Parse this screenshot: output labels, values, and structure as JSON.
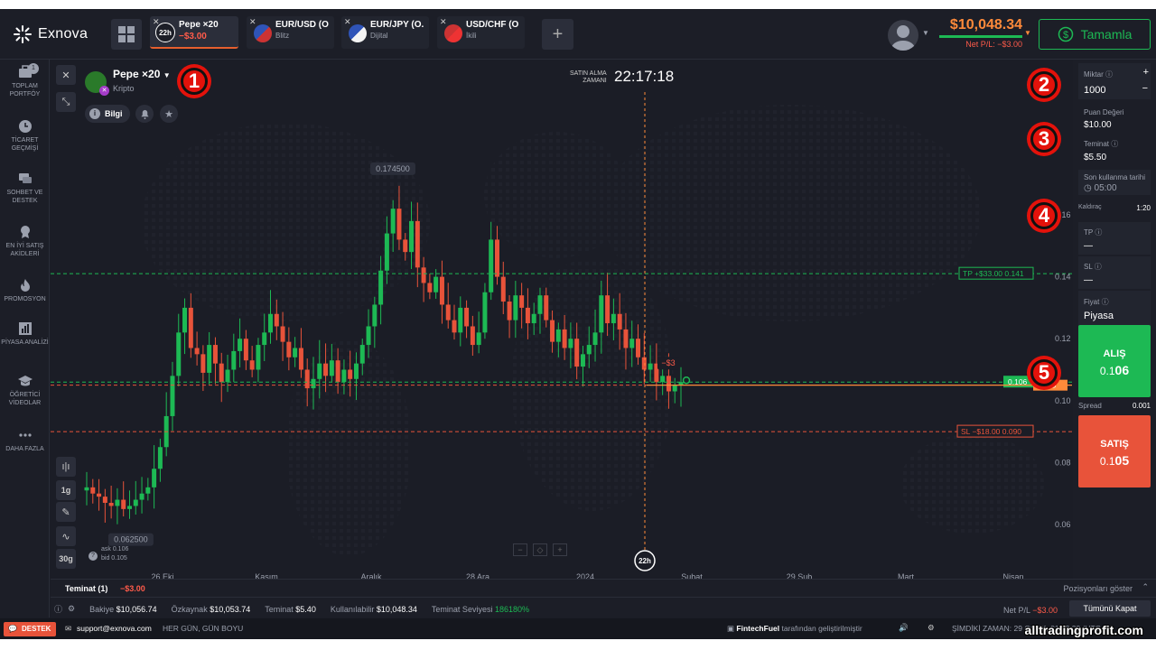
{
  "brand": "Exnova",
  "tabs": [
    {
      "name": "Pepe ×20",
      "sub": "−$3.00",
      "icon": "22h"
    },
    {
      "name": "EUR/USD (O...",
      "sub": "Blitz",
      "icon": "OTC"
    },
    {
      "name": "EUR/JPY (O...",
      "sub": "Dijital",
      "icon": "OTC"
    },
    {
      "name": "USD/CHF (O...",
      "sub": "İkili",
      "icon": "OTC"
    }
  ],
  "account": {
    "balance": "$10,048.34",
    "pl": "Net P/L: −$3.00",
    "deposit_label": "Tamamla"
  },
  "sidebar": [
    {
      "label": "TOPLAM PORTFÖY",
      "icon": "portfolio-icon",
      "badge": "1"
    },
    {
      "label": "TİCARET GEÇMİŞİ",
      "icon": "history-icon"
    },
    {
      "label": "SOHBET VE DESTEK",
      "icon": "chat-icon"
    },
    {
      "label": "EN İYİ SATIŞ AKİDLERİ",
      "icon": "award-icon"
    },
    {
      "label": "PROMOSYON",
      "icon": "flame-icon"
    },
    {
      "label": "PİYASA ANALİZİ",
      "icon": "chart-icon"
    },
    {
      "label": "ÖĞRETİCİ VİDEOLAR",
      "icon": "education-icon"
    },
    {
      "label": "DAHA FAZLA",
      "icon": "more-icon"
    }
  ],
  "asset": {
    "name": "Pepe ×20",
    "category": "Kripto",
    "info_label": "Bilgi"
  },
  "expiry": {
    "label_line1": "SATIN ALMA",
    "label_line2": "ZAMANI",
    "time": "22:17:18",
    "marker": "22h"
  },
  "chart_controls": {
    "timeframe": "1g",
    "zoom": "30g",
    "ask": "ask 0.106",
    "bid": "bid 0.105"
  },
  "chart_data": {
    "type": "candlestick",
    "x_ticks": [
      "26 Eki",
      "Kasım",
      "Aralık",
      "28 Ara",
      "2024",
      "Şubat",
      "29 Şub",
      "Mart",
      "Nisan"
    ],
    "y_ticks": [
      "0.16",
      "0.14",
      "0.12",
      "0.10",
      "0.08",
      "0.06"
    ],
    "high_label": "0.174500",
    "low_label": "0.062500",
    "tp_line": {
      "label": "TP",
      "pl": "+$33.00",
      "price": "0.141"
    },
    "sl_line": {
      "label": "SL",
      "pl": "−$18.00",
      "price": "0.090"
    },
    "open_line": {
      "price": "0.105",
      "pl": "−$3"
    },
    "current_price": "0.106",
    "closes": [
      0.072,
      0.07,
      0.069,
      0.067,
      0.066,
      0.068,
      0.065,
      0.066,
      0.068,
      0.07,
      0.072,
      0.078,
      0.085,
      0.095,
      0.108,
      0.122,
      0.13,
      0.117,
      0.115,
      0.109,
      0.118,
      0.112,
      0.106,
      0.11,
      0.116,
      0.12,
      0.113,
      0.11,
      0.118,
      0.122,
      0.128,
      0.124,
      0.119,
      0.114,
      0.117,
      0.11,
      0.104,
      0.107,
      0.112,
      0.108,
      0.113,
      0.106,
      0.11,
      0.107,
      0.112,
      0.118,
      0.124,
      0.131,
      0.142,
      0.154,
      0.162,
      0.152,
      0.148,
      0.158,
      0.143,
      0.138,
      0.135,
      0.14,
      0.131,
      0.126,
      0.122,
      0.13,
      0.124,
      0.118,
      0.122,
      0.135,
      0.152,
      0.14,
      0.132,
      0.126,
      0.134,
      0.13,
      0.125,
      0.128,
      0.134,
      0.126,
      0.119,
      0.123,
      0.117,
      0.12,
      0.111,
      0.115,
      0.118,
      0.122,
      0.134,
      0.125,
      0.128,
      0.123,
      0.117,
      0.12,
      0.114,
      0.11,
      0.112,
      0.106,
      0.108,
      0.103,
      0.105,
      0.106
    ]
  },
  "panel": {
    "amount": {
      "label": "Miktar",
      "value": "1000"
    },
    "point_value": {
      "label": "Puan Değeri",
      "value": "$10.00"
    },
    "margin": {
      "label": "Teminat",
      "value": "$5.50"
    },
    "expiry": {
      "label": "Son kullanma tarihi",
      "value": "05:00"
    },
    "leverage": {
      "label": "Kaldıraç",
      "value": "1:20"
    },
    "tp": {
      "label": "TP",
      "value": "—"
    },
    "sl": {
      "label": "SL",
      "value": "—"
    },
    "price": {
      "label": "Fiyat",
      "value": "Piyasa"
    },
    "buy": {
      "label": "ALIŞ",
      "price_a": "0.1",
      "price_b": "06"
    },
    "spread": {
      "label": "Spread",
      "value": "0.001"
    },
    "sell": {
      "label": "SATIŞ",
      "price_a": "0.1",
      "price_b": "05"
    }
  },
  "bottom": {
    "positions_label": "Teminat (1)",
    "positions_pl": "−$3.00",
    "show_positions": "Pozisyonları göster",
    "balance_label": "Bakiye",
    "balance": "$10,056.74",
    "equity_label": "Özkaynak",
    "equity": "$10,053.74",
    "margin_label": "Teminat",
    "margin": "$5.40",
    "available_label": "Kullanılabilir",
    "available": "$10,048.34",
    "margin_level_label": "Teminat Seviyesi",
    "margin_level": "186180%",
    "net_pl_label": "Net P/L",
    "net_pl": "−$3.00",
    "close_all": "Tümünü Kapat"
  },
  "footer": {
    "support_label": "DESTEK",
    "email": "support@exnova.com",
    "hours": "HER GÜN, GÜN BOYU",
    "powered": "FintechFuel",
    "powered_suffix": "tarafından geliştirilmiştir",
    "time_label": "ŞİMDİKİ ZAMAN:",
    "time_value": "29 OCAK, 01:42:33 (UTC+3)",
    "watermark": "alltradingprofit.com"
  },
  "annotations": [
    "1",
    "2",
    "3",
    "4",
    "5"
  ],
  "colors": {
    "up": "#1db954",
    "down": "#e8533a",
    "accent": "#ff8a3a",
    "bg": "#1b1d26"
  }
}
